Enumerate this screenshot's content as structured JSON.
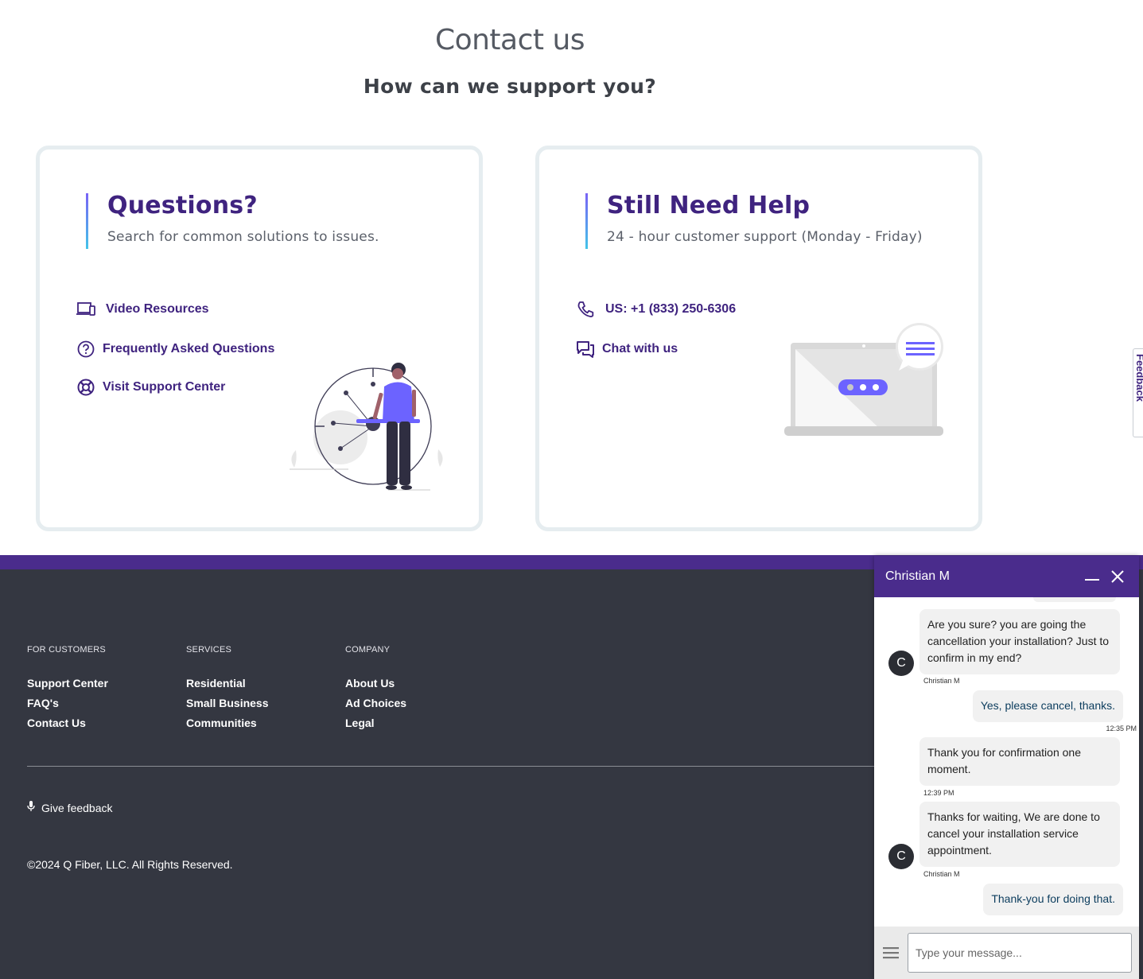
{
  "header": {
    "title": "Contact us",
    "subtitle": "How can we support you?"
  },
  "questions_card": {
    "title": "Questions?",
    "description": "Search for common solutions to issues.",
    "links": [
      {
        "label": "Video Resources",
        "icon": "devices-icon"
      },
      {
        "label": "Frequently Asked Questions",
        "icon": "question-circle-icon"
      },
      {
        "label": "Visit Support Center",
        "icon": "lifebuoy-icon"
      }
    ]
  },
  "help_card": {
    "title": "Still Need Help",
    "description": "24 - hour customer support (Monday - Friday)",
    "links": [
      {
        "label": "US: +1 (833) 250-6306",
        "icon": "phone-icon"
      },
      {
        "label": "Chat with us",
        "icon": "chat-icon"
      }
    ]
  },
  "feedback_tab": {
    "label": "Feedback"
  },
  "footer": {
    "columns": [
      {
        "heading": "FOR CUSTOMERS",
        "links": [
          "Support Center",
          "FAQ's",
          "Contact Us"
        ]
      },
      {
        "heading": "SERVICES",
        "links": [
          "Residential",
          "Small Business",
          "Communities"
        ]
      },
      {
        "heading": "COMPANY",
        "links": [
          "About Us",
          "Ad Choices",
          "Legal"
        ]
      }
    ],
    "give_feedback": "Give feedback",
    "copyright": "©2024 Q Fiber, LLC. All Rights Reserved."
  },
  "chat": {
    "agent_name": "Christian M",
    "avatar_initial": "C",
    "messages": [
      {
        "from": "agent",
        "text": "Are you sure? you are going the cancellation your installation? Just to confirm in my end?",
        "meta": "Christian M"
      },
      {
        "from": "user",
        "text": "Yes, please cancel, thanks.",
        "meta": "12:35 PM"
      },
      {
        "from": "agent",
        "text": "Thank you for confirmation one moment.",
        "meta": "12:39 PM"
      },
      {
        "from": "agent",
        "text": "Thanks for waiting, We are done to cancel your installation service appointment.",
        "meta": "Christian M"
      },
      {
        "from": "user",
        "text": "Thank-you for doing that."
      }
    ],
    "input_placeholder": "Type your message..."
  },
  "colors": {
    "brand_purple": "#3f237f",
    "header_purple": "#4a2c8c",
    "footer_bg": "#343741",
    "accent_violet": "#6c63ff"
  }
}
